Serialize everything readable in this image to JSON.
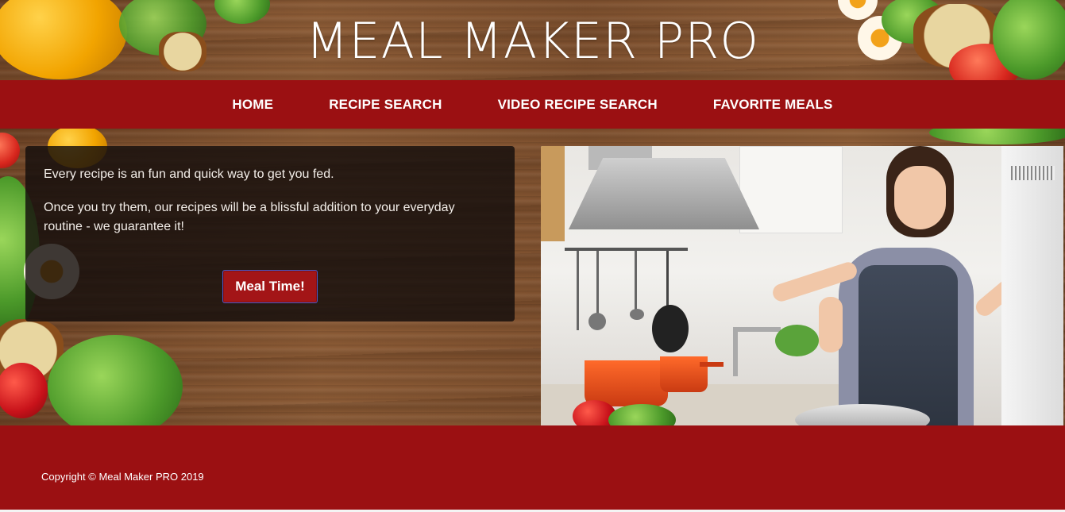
{
  "header": {
    "title": "MEAL MAKER PRO"
  },
  "nav": {
    "items": [
      {
        "label": "HOME"
      },
      {
        "label": "RECIPE SEARCH"
      },
      {
        "label": "VIDEO RECIPE SEARCH"
      },
      {
        "label": "FAVORITE MEALS"
      }
    ]
  },
  "intro": {
    "line1": "Every recipe is an fun and quick way to get you fed.",
    "line2": "Once you try them, our recipes will be a blissful addition to your everyday routine - we guarantee it!",
    "button_label": "Meal Time!"
  },
  "footer": {
    "copyright": "Copyright © Meal Maker PRO 2019"
  },
  "colors": {
    "brand_red": "#9b1012",
    "button_red": "#a31517",
    "wood": "#7a4e2d"
  }
}
